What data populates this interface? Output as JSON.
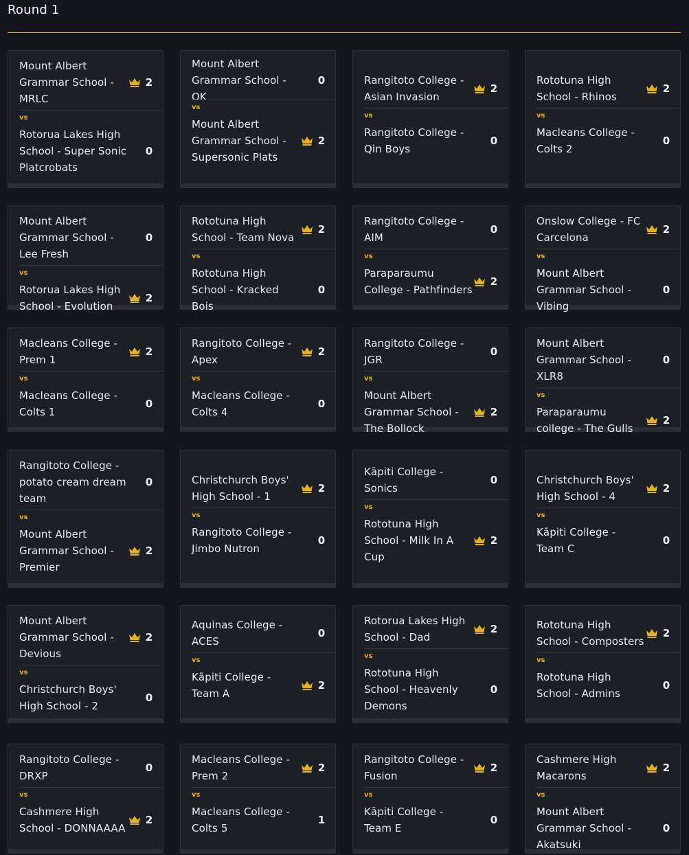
{
  "round": {
    "title": "Round 1"
  },
  "colors": {
    "accent": "#e3b31b",
    "background": "#15171d",
    "card": "#1c1f26"
  },
  "vs_label": "vs",
  "matches": [
    {
      "team1": {
        "name": "Mount Albert Grammar School - MRLC",
        "score": "2",
        "winner": true
      },
      "team2": {
        "name": "Rotorua Lakes High School - Super Sonic Platcrobats",
        "score": "0",
        "winner": false
      }
    },
    {
      "team1": {
        "name": "Mount Albert Grammar School - OK",
        "score": "0",
        "winner": false
      },
      "team2": {
        "name": "Mount Albert Grammar School - Supersonic Plats",
        "score": "2",
        "winner": true
      }
    },
    {
      "team1": {
        "name": "Rangitoto College - Asian Invasion",
        "score": "2",
        "winner": true
      },
      "team2": {
        "name": "Rangitoto College - Qin Boys",
        "score": "0",
        "winner": false
      }
    },
    {
      "team1": {
        "name": "Rototuna High School - Rhinos",
        "score": "2",
        "winner": true
      },
      "team2": {
        "name": "Macleans College - Colts 2",
        "score": "0",
        "winner": false
      }
    },
    {
      "team1": {
        "name": "Mount Albert Grammar School - Lee Fresh",
        "score": "0",
        "winner": false
      },
      "team2": {
        "name": "Rotorua Lakes High School - Evolution",
        "score": "2",
        "winner": true
      }
    },
    {
      "team1": {
        "name": "Rototuna High School - Team Nova",
        "score": "2",
        "winner": true
      },
      "team2": {
        "name": "Rototuna High School - Kracked Bois",
        "score": "0",
        "winner": false
      }
    },
    {
      "team1": {
        "name": "Rangitoto College - AIM",
        "score": "0",
        "winner": false
      },
      "team2": {
        "name": "Paraparaumu College - Pathfinders",
        "score": "2",
        "winner": true
      }
    },
    {
      "team1": {
        "name": "Onslow College - FC Carcelona",
        "score": "2",
        "winner": true
      },
      "team2": {
        "name": "Mount Albert Grammar School - Vibing",
        "score": "0",
        "winner": false
      }
    },
    {
      "team1": {
        "name": "Macleans College - Prem 1",
        "score": "2",
        "winner": true
      },
      "team2": {
        "name": "Macleans College - Colts 1",
        "score": "0",
        "winner": false
      }
    },
    {
      "team1": {
        "name": "Rangitoto College - Apex",
        "score": "2",
        "winner": true
      },
      "team2": {
        "name": "Macleans College - Colts 4",
        "score": "0",
        "winner": false
      }
    },
    {
      "team1": {
        "name": "Rangitoto College - JGR",
        "score": "0",
        "winner": false
      },
      "team2": {
        "name": "Mount Albert Grammar School - The Bollock",
        "score": "2",
        "winner": true
      }
    },
    {
      "team1": {
        "name": "Mount Albert Grammar School - XLR8",
        "score": "0",
        "winner": false
      },
      "team2": {
        "name": "Paraparaumu college - The Gulls",
        "score": "2",
        "winner": true
      }
    },
    {
      "team1": {
        "name": "Rangitoto College - potato cream dream team",
        "score": "0",
        "winner": false
      },
      "team2": {
        "name": "Mount Albert Grammar School - Premier",
        "score": "2",
        "winner": true
      }
    },
    {
      "team1": {
        "name": "Christchurch Boys' High School - 1",
        "score": "2",
        "winner": true
      },
      "team2": {
        "name": "Rangitoto College - Jimbo Nutron",
        "score": "0",
        "winner": false
      }
    },
    {
      "team1": {
        "name": "Kāpiti College - Sonics",
        "score": "0",
        "winner": false
      },
      "team2": {
        "name": "Rototuna High School - Milk In A Cup",
        "score": "2",
        "winner": true
      }
    },
    {
      "team1": {
        "name": "Christchurch Boys' High School - 4",
        "score": "2",
        "winner": true
      },
      "team2": {
        "name": "Kāpiti College - Team C",
        "score": "0",
        "winner": false
      }
    },
    {
      "team1": {
        "name": "Mount Albert Grammar School - Devious",
        "score": "2",
        "winner": true
      },
      "team2": {
        "name": "Christchurch Boys' High School - 2",
        "score": "0",
        "winner": false
      }
    },
    {
      "team1": {
        "name": "Aquinas College - ACES",
        "score": "0",
        "winner": false
      },
      "team2": {
        "name": "Kāpiti College - Team A",
        "score": "2",
        "winner": true
      }
    },
    {
      "team1": {
        "name": "Rotorua Lakes High School - Dad",
        "score": "2",
        "winner": true
      },
      "team2": {
        "name": "Rototuna High School - Heavenly Demons",
        "score": "0",
        "winner": false
      }
    },
    {
      "team1": {
        "name": "Rototuna High School - Composters",
        "score": "2",
        "winner": true
      },
      "team2": {
        "name": "Rototuna High School - Admins",
        "score": "0",
        "winner": false
      }
    },
    {
      "team1": {
        "name": "Rangitoto College - DRXP",
        "score": "0",
        "winner": false
      },
      "team2": {
        "name": "Cashmere High School - DONNAAAA",
        "score": "2",
        "winner": true
      }
    },
    {
      "team1": {
        "name": "Macleans College - Prem 2",
        "score": "2",
        "winner": true
      },
      "team2": {
        "name": "Macleans College - Colts 5",
        "score": "1",
        "winner": false
      }
    },
    {
      "team1": {
        "name": "Rangitoto College - Fusion",
        "score": "2",
        "winner": true
      },
      "team2": {
        "name": "Kāpiti College - Team E",
        "score": "0",
        "winner": false
      }
    },
    {
      "team1": {
        "name": "Cashmere High Macarons",
        "score": "2",
        "winner": true
      },
      "team2": {
        "name": "Mount Albert Grammar School - Akatsuki",
        "score": "0",
        "winner": false
      }
    }
  ]
}
